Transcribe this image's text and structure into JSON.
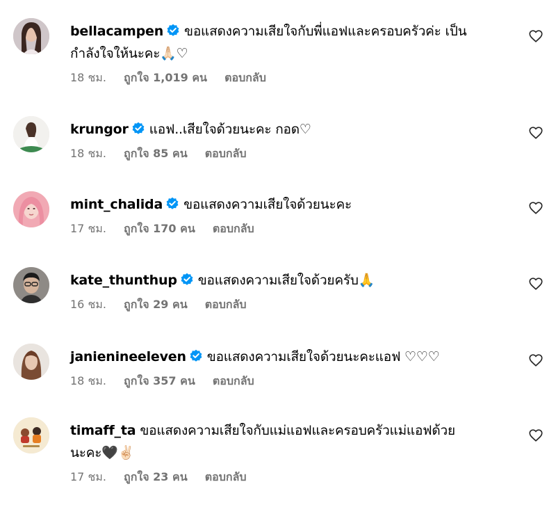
{
  "colors": {
    "verified": "#0095F6",
    "meta": "#737373",
    "text": "#000000"
  },
  "comments": [
    {
      "username": "bellacampen",
      "verified": true,
      "text_line1": "ขอแสดงความเสียใจกับพี่แอฟและครอบครัวค่ะ เป็น",
      "text_line2": "กำลังใจให้นะคะ🙏🏻♡",
      "time": "18 ชม.",
      "likes": "ถูกใจ 1,019 คน",
      "reply": "ตอบกลับ"
    },
    {
      "username": "krungor",
      "verified": true,
      "text_line1": "แอฟ..เสียใจด้วยนะคะ กอด♡",
      "time": "18 ชม.",
      "likes": "ถูกใจ 85 คน",
      "reply": "ตอบกลับ"
    },
    {
      "username": "mint_chalida",
      "verified": true,
      "text_line1": "ขอแสดงความเสียใจด้วยนะคะ",
      "time": "17 ชม.",
      "likes": "ถูกใจ 170 คน",
      "reply": "ตอบกลับ"
    },
    {
      "username": "kate_thunthup",
      "verified": true,
      "text_line1": "ขอแสดงความเสียใจด้วยครับ🙏",
      "time": "16 ชม.",
      "likes": "ถูกใจ 29 คน",
      "reply": "ตอบกลับ"
    },
    {
      "username": "janienineeleven",
      "verified": true,
      "text_line1": "ขอแสดงความเสียใจด้วยนะคะแอฟ ♡♡♡",
      "time": "18 ชม.",
      "likes": "ถูกใจ 357 คน",
      "reply": "ตอบกลับ"
    },
    {
      "username": "timaff_ta",
      "verified": false,
      "text_line1": "ขอแสดงความเสียใจกับแม่แอฟและครอบครัวแม่แอฟด้วย",
      "text_line2": "นะคะ🖤✌🏻",
      "time": "17 ชม.",
      "likes": "ถูกใจ 23 คน",
      "reply": "ตอบกลับ"
    }
  ]
}
